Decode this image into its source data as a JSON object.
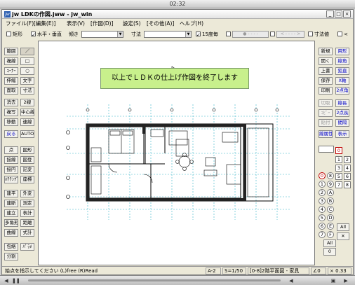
{
  "player": {
    "time": "02:32"
  },
  "window": {
    "title": "jw LDKの作図.jww - jw_win",
    "icon_text": "jw"
  },
  "menu": [
    "ファイル(F)",
    "[編集(E)]",
    "表示(V)",
    "[作図(D)]",
    "設定(S)",
    "[その他(A)]",
    "ヘルプ(H)"
  ],
  "toolbar": {
    "rect_label": "矩形",
    "hv_label": "水平・垂直",
    "tilt_label": "傾き",
    "dim_label": "寸法",
    "step15_label": "15度毎",
    "dim_value_label": "寸法値"
  },
  "left_tools": [
    [
      "範囲",
      "／"
    ],
    [
      "複線",
      "□"
    ],
    [
      "ｺｰﾅｰ",
      "○"
    ],
    [
      "伸縮",
      "文字"
    ],
    [
      "面取",
      "寸法"
    ],
    [
      "消去",
      "2線"
    ],
    [
      "複写",
      "中心線"
    ],
    [
      "移動",
      "連線"
    ],
    [
      "戻る",
      "AUTO"
    ],
    [
      "点",
      "図形"
    ],
    [
      "接線",
      "図登"
    ],
    [
      "接円",
      "記変"
    ],
    [
      "ﾊﾁﾁﾝｸﾞ",
      "座標"
    ],
    [
      "建平",
      "外変"
    ],
    [
      "建断",
      "測定"
    ],
    [
      "建立",
      "表計"
    ],
    [
      "多角形",
      "距離"
    ],
    [
      "曲線",
      "式計"
    ],
    [
      "包絡",
      "ﾊﾟﾗﾒ"
    ],
    [
      "分割",
      ""
    ]
  ],
  "right_tools": [
    [
      "新規",
      "用形"
    ],
    [
      "開く",
      "線角"
    ],
    [
      "上書",
      "鉛直"
    ],
    [
      "保存",
      "X軸"
    ],
    [
      "印刷",
      "2点角"
    ],
    [
      "切取",
      "線長"
    ],
    [
      "ｺﾋﾟｰ",
      "2点長"
    ],
    [
      "貼付",
      "間隔"
    ],
    [
      "線属性",
      "表示"
    ]
  ],
  "layers": {
    "group_labels": [
      "0",
      "1",
      "2",
      "3",
      "4",
      "5",
      "6",
      "7",
      "8",
      "9",
      "A",
      "B",
      "C",
      "D",
      "E",
      "F"
    ],
    "all_label": "All",
    "zero_label": "0"
  },
  "canvas": {
    "message": "以上でＬＤＫの仕上げ作図を終了します",
    "message_bg": "#c8f08c"
  },
  "status": {
    "hint": "始点を指示してください (L)free (R)Read",
    "paper": "A-2",
    "scale": "S=1/50",
    "layer": "[0-8]2階平面図 - 家具",
    "angle": "∠0",
    "zoom": "× 0.33"
  },
  "colors": {
    "accent_blue": "#0000c8",
    "accent_red": "#c80000"
  }
}
